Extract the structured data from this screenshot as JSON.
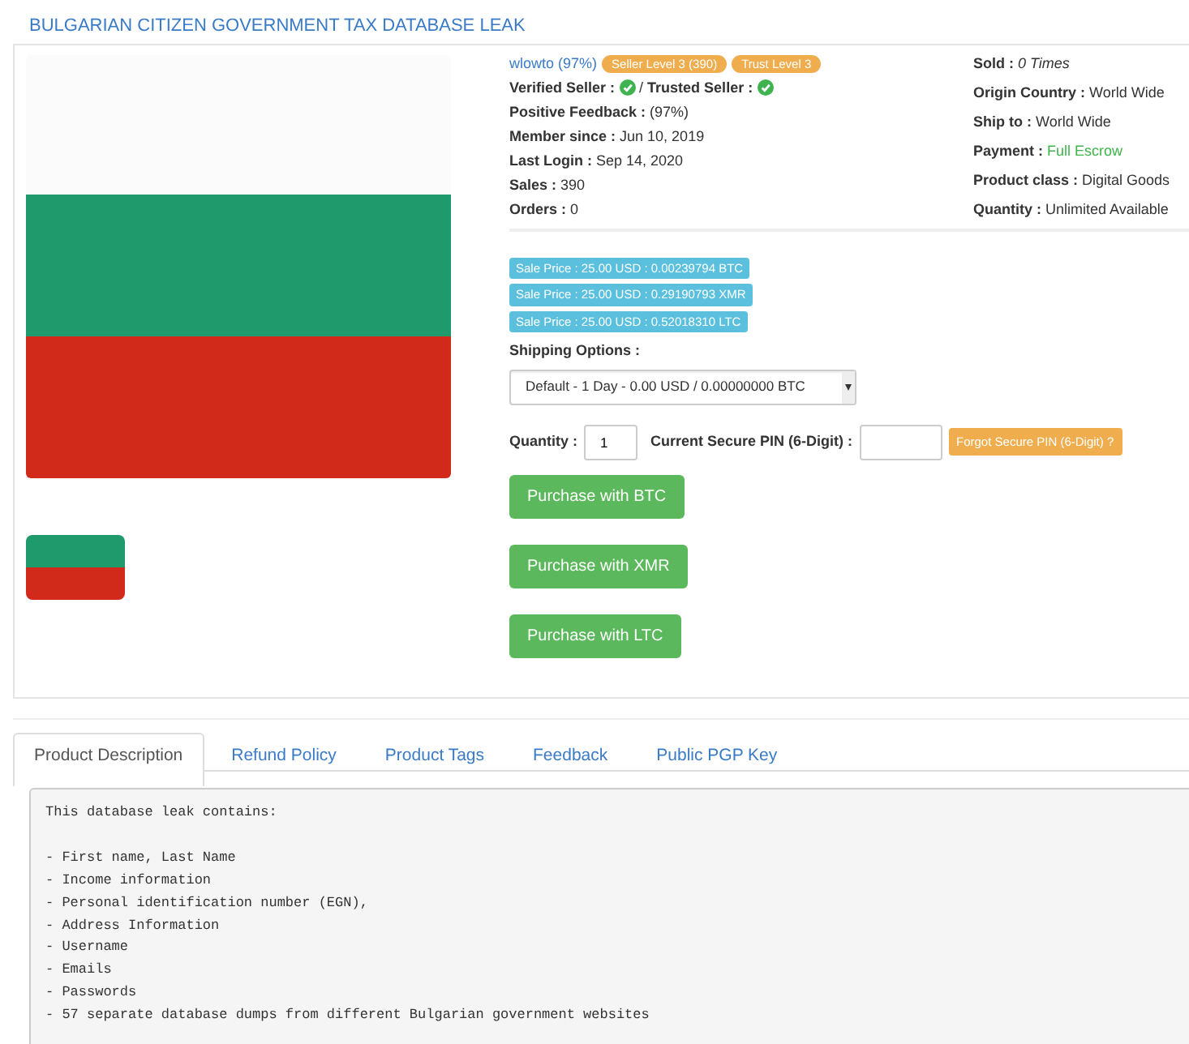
{
  "title": "BULGARIAN CITIZEN GOVERNMENT TAX DATABASE LEAK",
  "vendor": {
    "name": "wlowto (97%)",
    "badges": [
      "Seller Level 3 (390)",
      "Trust Level 3"
    ]
  },
  "verification": [
    {
      "label": "Verified Seller :",
      "checked": true
    },
    {
      "label": "Trusted Seller :",
      "checked": true
    }
  ],
  "verification_separator": "/",
  "vendor_stats": [
    {
      "label": "Positive Feedback :",
      "value": "(97%)"
    },
    {
      "label": "Member since :",
      "value": "Jun 10, 2019"
    },
    {
      "label": "Last Login :",
      "value": "Sep 14, 2020"
    },
    {
      "label": "Sales :",
      "value": "390"
    },
    {
      "label": "Orders :",
      "value": "0"
    }
  ],
  "listing_info": [
    {
      "label": "Sold :",
      "value": "0 Times",
      "kind": "italic"
    },
    {
      "label": "Origin Country :",
      "value": "World Wide",
      "kind": "plain"
    },
    {
      "label": "Ship to :",
      "value": "World Wide",
      "kind": "plain"
    },
    {
      "label": "Payment :",
      "value": "Full Escrow",
      "kind": "success"
    },
    {
      "label": "Product class :",
      "value": "Digital Goods",
      "kind": "plain"
    },
    {
      "label": "Quantity :",
      "value": "Unlimited Available",
      "kind": "plain"
    }
  ],
  "prices": [
    "Sale Price : 25.00 USD : 0.00239794 BTC",
    "Sale Price : 25.00 USD : 0.29190793 XMR",
    "Sale Price : 25.00 USD : 0.52018310 LTC"
  ],
  "shipping": {
    "label": "Shipping Options :",
    "value": "Default - 1 Day - 0.00 USD / 0.00000000 BTC"
  },
  "quantity": {
    "label": "Quantity :",
    "value": "1"
  },
  "pin": {
    "label": "Current Secure PIN (6-Digit) :"
  },
  "forgot_pin_button": "Forgot Secure PIN (6-Digit) ?",
  "purchase_buttons": [
    "Purchase with BTC",
    "Purchase with XMR",
    "Purchase with LTC"
  ],
  "tabs": [
    {
      "label": "Product Description",
      "selected": true
    },
    {
      "label": "Refund Policy",
      "selected": false
    },
    {
      "label": "Product Tags",
      "selected": false
    },
    {
      "label": "Feedback",
      "selected": false
    },
    {
      "label": "Public PGP Key",
      "selected": false
    }
  ],
  "description": "This database leak contains:\n\n- First name, Last Name\n- Income information\n- Personal identification number (EGN),\n- Address Information\n- Username\n- Emails\n- Passwords\n- 57 separate database dumps from different Bulgarian government websites"
}
